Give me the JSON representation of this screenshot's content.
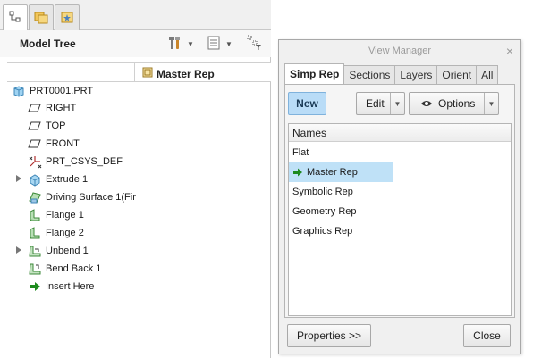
{
  "left_panel": {
    "tabs": [
      {
        "icon": "model-tree-icon",
        "active": true
      },
      {
        "icon": "folder-browser-icon",
        "active": false
      },
      {
        "icon": "favorites-icon",
        "active": false
      }
    ],
    "toolbar": {
      "title": "Model Tree",
      "tools_icon": "settings-tools-icon",
      "show_icon": "list-columns-icon",
      "filter_icon": "tree-filter-icon"
    },
    "column_header": "Master Rep",
    "tree_items": [
      {
        "label": "PRT0001.PRT",
        "icon": "part-icon"
      },
      {
        "label": "RIGHT",
        "icon": "datum-plane-icon"
      },
      {
        "label": "TOP",
        "icon": "datum-plane-icon"
      },
      {
        "label": "FRONT",
        "icon": "datum-plane-icon"
      },
      {
        "label": "PRT_CSYS_DEF",
        "icon": "csys-icon"
      },
      {
        "label": "Extrude 1",
        "icon": "extrude-icon"
      },
      {
        "label": "Driving Surface 1(Fir",
        "icon": "driving-surface-icon"
      },
      {
        "label": "Flange 1",
        "icon": "flange-icon"
      },
      {
        "label": "Flange 2",
        "icon": "flange-icon"
      },
      {
        "label": "Unbend 1",
        "icon": "unbend-icon"
      },
      {
        "label": "Bend Back 1",
        "icon": "bend-back-icon"
      },
      {
        "label": "Insert Here",
        "icon": "insert-arrow-icon"
      }
    ]
  },
  "view_manager": {
    "title": "View Manager",
    "close_glyph": "×",
    "tabs": [
      "Simp Rep",
      "Sections",
      "Layers",
      "Orient",
      "All"
    ],
    "active_tab": "Simp Rep",
    "buttons": {
      "new": "New",
      "edit": "Edit",
      "options": "Options",
      "properties": "Properties >>",
      "close": "Close"
    },
    "list_header": "Names",
    "reps": [
      "Flat",
      "Master Rep",
      "Symbolic Rep",
      "Geometry Rep",
      "Graphics Rep"
    ],
    "selected_rep": "Master Rep",
    "colors": {
      "new_button": "#b9dcf7",
      "selected_row": "#bfe1f7",
      "active_arrow": "#1e8a1e"
    }
  }
}
